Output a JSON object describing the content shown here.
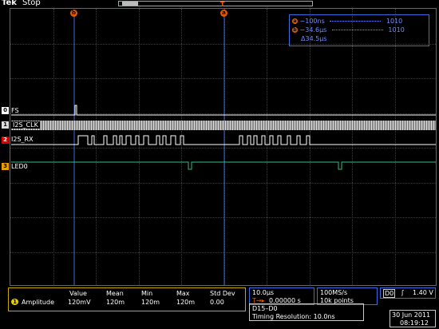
{
  "header": {
    "brand": "Tek",
    "state": "Stop"
  },
  "cursors": {
    "marker_a": "a",
    "marker_b": "b",
    "readout": {
      "a_time": "−100ns",
      "a_value": "1010",
      "b_time": "−34.6μs",
      "b_value": "1010",
      "delta": "Δ34.5μs"
    }
  },
  "trigger_marker": "T",
  "channels": [
    {
      "tag": "0",
      "label": "FS",
      "color": "#ffffff"
    },
    {
      "tag": "1",
      "label": "I2S_CLK",
      "color": "#cccccc"
    },
    {
      "tag": "2",
      "label": "I2S_RX",
      "color": "#ffffff"
    },
    {
      "tag": "3",
      "label": "LED0",
      "color": "#ffffff"
    }
  ],
  "measurement": {
    "channel": "1",
    "name": "Amplitude",
    "headers": [
      "Value",
      "Mean",
      "Min",
      "Max",
      "Std Dev"
    ],
    "values": [
      "120mV",
      "120m",
      "120m",
      "120m",
      "0.00"
    ]
  },
  "timebase": {
    "scale": "10.0μs",
    "position": "0.00000 s",
    "position_prefix": "T→▸"
  },
  "acquisition": {
    "rate": "100MS/s",
    "points": "10k points"
  },
  "trigger": {
    "source": "D0",
    "slope": "ʃ",
    "level": "1.40 V"
  },
  "digital": {
    "channels": "D15–D0",
    "resolution": "Timing Resolution: 10.0ns"
  },
  "datetime": {
    "date": "30 Jun  2011",
    "time": "08:19:12"
  }
}
